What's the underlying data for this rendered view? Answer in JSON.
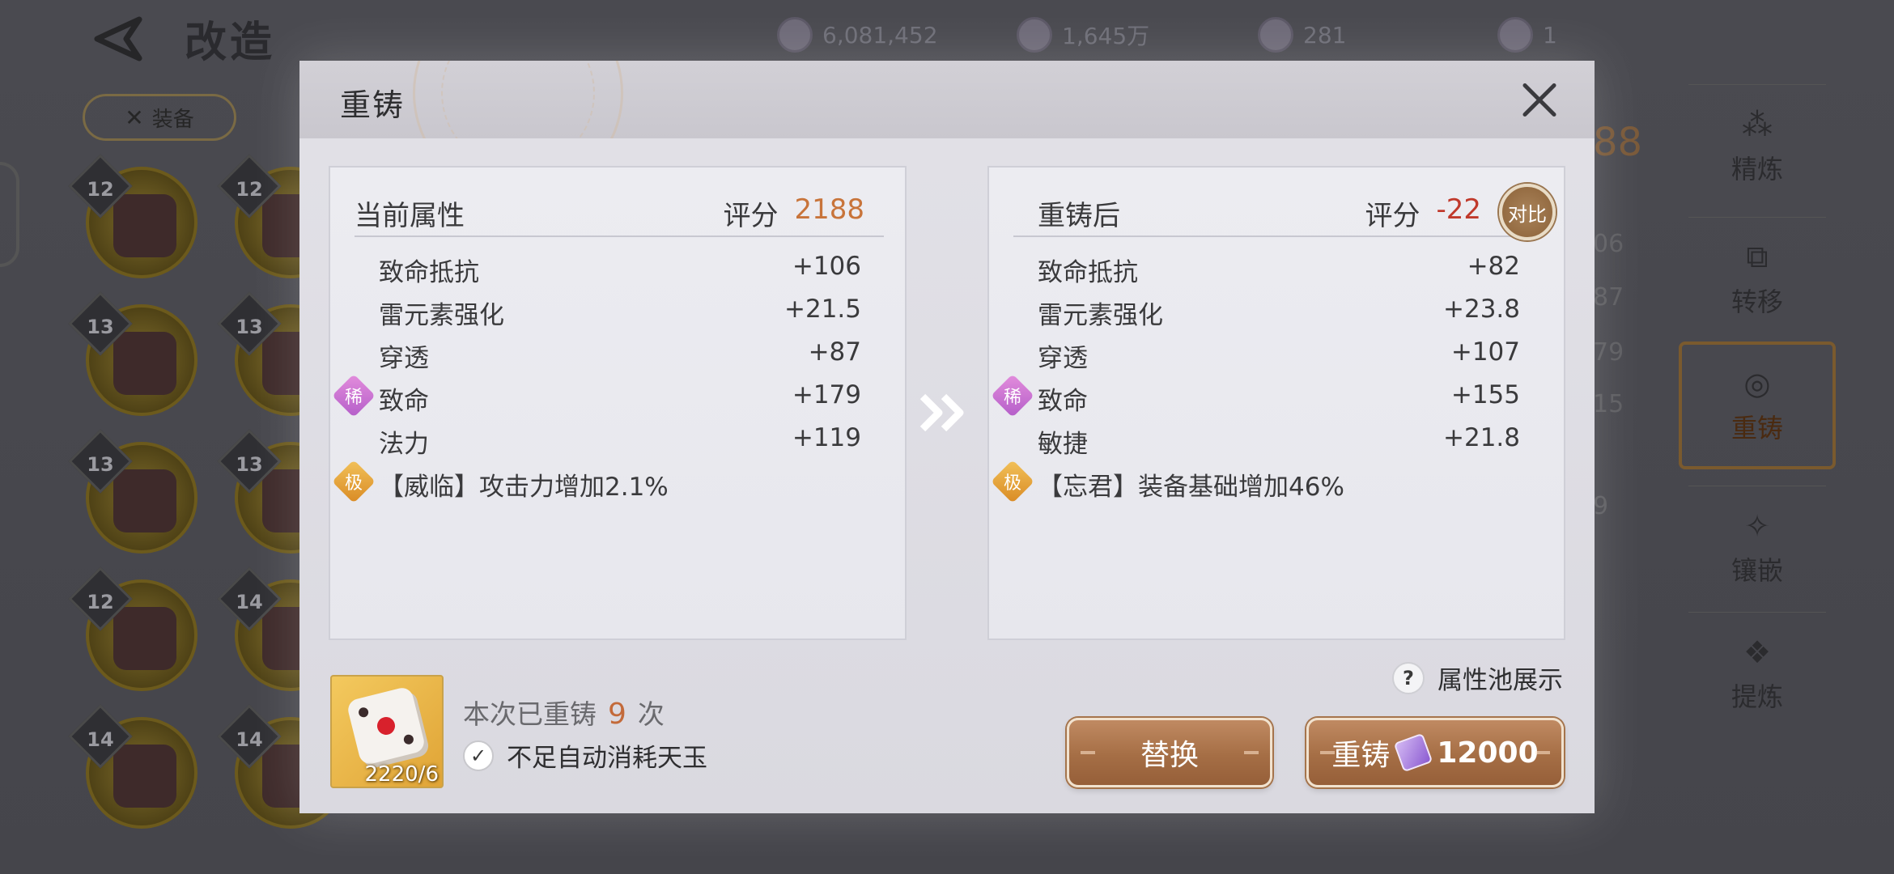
{
  "background": {
    "page_title": "改造",
    "currencies": [
      {
        "icon": "purple-gem-icon",
        "value": "6,081,452"
      },
      {
        "icon": "silver-coin-icon",
        "value": "1,645万"
      },
      {
        "icon": "blue-token-icon",
        "value": "281"
      },
      {
        "icon": "gold-token-icon",
        "value": "1"
      }
    ],
    "equip_tab_label": "装备",
    "slot_levels": [
      "12",
      "12",
      "13",
      "13",
      "13",
      "13",
      "12",
      "14",
      "14",
      "14"
    ],
    "side_nav": [
      {
        "label": "精炼",
        "icon": "refine-icon"
      },
      {
        "label": "转移",
        "icon": "transfer-icon"
      },
      {
        "label": "重铸",
        "icon": "recast-icon",
        "active": true
      },
      {
        "label": "镶嵌",
        "icon": "inlay-icon"
      },
      {
        "label": "提炼",
        "icon": "extract-icon"
      }
    ],
    "partial_numbers": [
      "88",
      "06",
      "87",
      "79",
      "15",
      "9"
    ]
  },
  "modal": {
    "title": "重铸",
    "current": {
      "heading": "当前属性",
      "score_label": "评分",
      "score_value": "2188",
      "attributes": [
        {
          "name": "致命抵抗",
          "value": "+106"
        },
        {
          "name": "雷元素强化",
          "value": "+21.5"
        },
        {
          "name": "穿透",
          "value": "+87"
        },
        {
          "name": "致命",
          "value": "+179",
          "tag": "稀"
        },
        {
          "name": "法力",
          "value": "+119"
        }
      ],
      "special": {
        "tag": "极",
        "text": "【威临】攻击力增加2.1%"
      }
    },
    "after": {
      "heading": "重铸后",
      "score_label": "评分",
      "score_value": "-22",
      "compare_label": "对比",
      "attributes": [
        {
          "name": "致命抵抗",
          "value": "+82"
        },
        {
          "name": "雷元素强化",
          "value": "+23.8"
        },
        {
          "name": "穿透",
          "value": "+107"
        },
        {
          "name": "致命",
          "value": "+155",
          "tag": "稀"
        },
        {
          "name": "敏捷",
          "value": "+21.8"
        }
      ],
      "special": {
        "tag": "极",
        "text": "【忘君】装备基础增加46%"
      }
    },
    "item_count": "2220/6",
    "recast_prefix": "本次已重铸",
    "recast_count": "9",
    "recast_suffix": "次",
    "auto_consume_label": "不足自动消耗天玉",
    "auto_consume_checked": true,
    "pool_label": "属性池展示",
    "replace_button": "替换",
    "recast_button": "重铸",
    "recast_cost": "12000"
  },
  "colors": {
    "score_positive": "#c8743a",
    "score_negative": "#c0392b",
    "button_brown": "#a56e45",
    "rare_tag": "#c770d0",
    "extreme_tag": "#e3a43a"
  }
}
